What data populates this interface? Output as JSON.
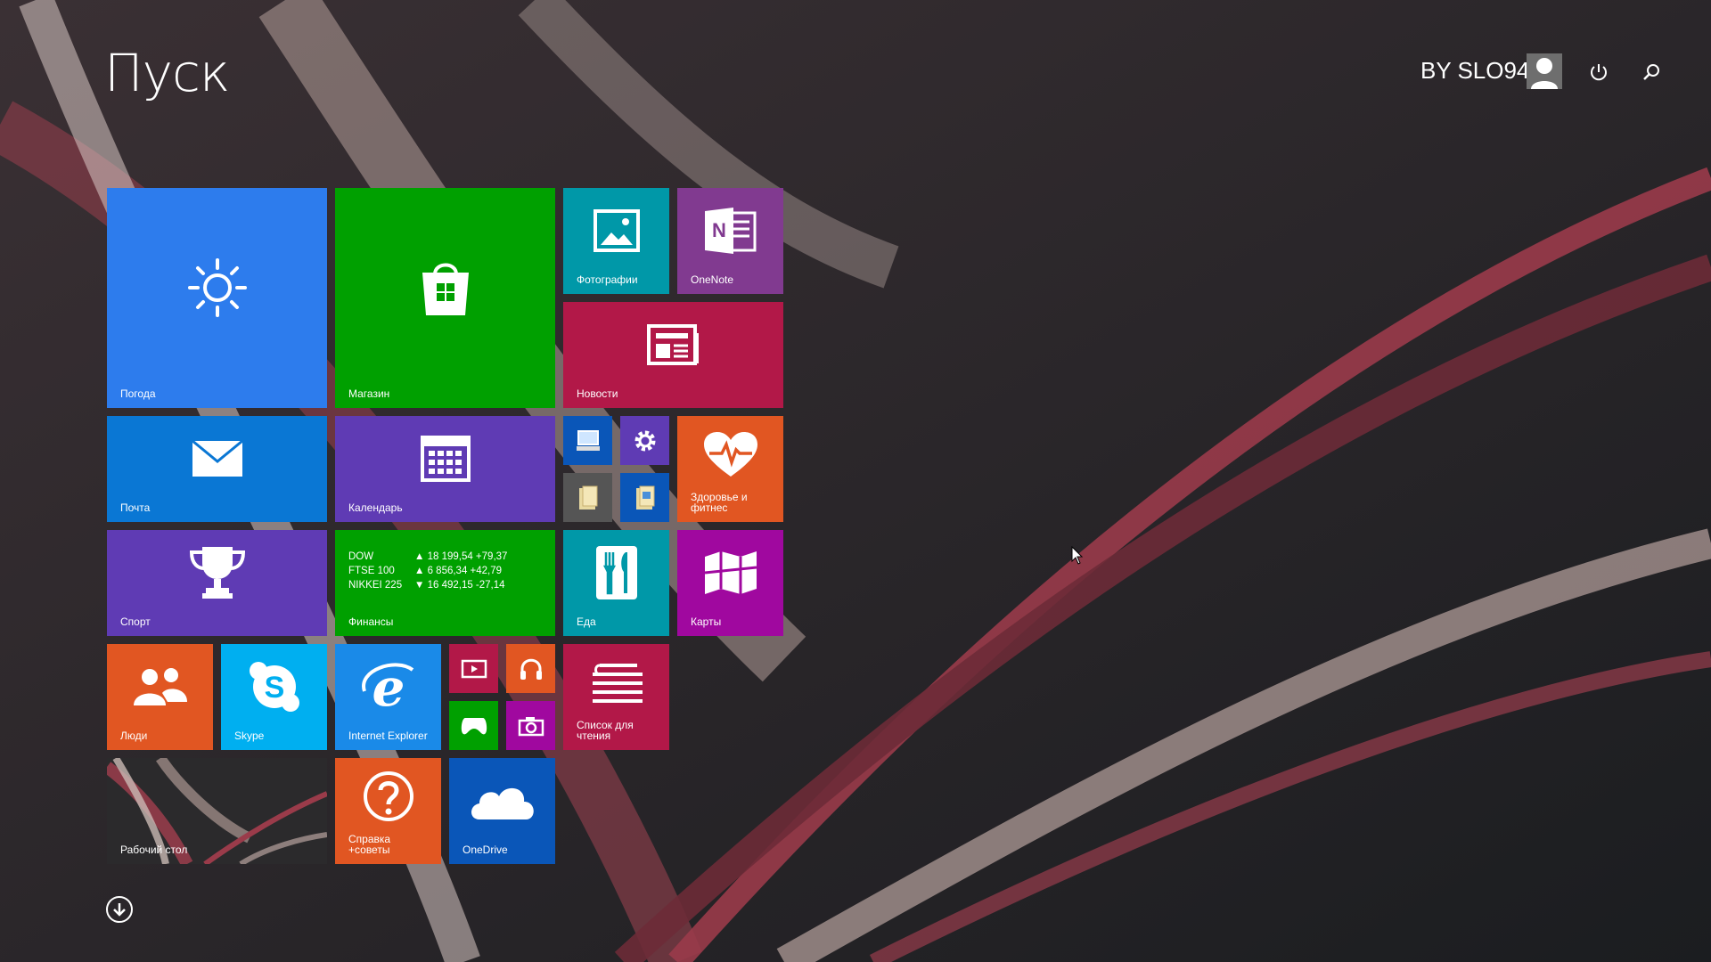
{
  "start": {
    "title": "Пуск"
  },
  "user": {
    "name": "BY SLO94"
  },
  "icons": {
    "power": "power-icon",
    "search": "search-icon",
    "down": "arrow-down-circle-icon"
  },
  "tiles": {
    "weather": {
      "label": "Погода",
      "color": "#2d7ced"
    },
    "store": {
      "label": "Магазин",
      "color": "#00a000"
    },
    "photos": {
      "label": "Фотографии",
      "color": "#0098a8"
    },
    "onenote": {
      "label": "OneNote",
      "color": "#813a90"
    },
    "news": {
      "label": "Новости",
      "color": "#b21848"
    },
    "mail": {
      "label": "Почта",
      "color": "#0a77d4"
    },
    "calendar": {
      "label": "Календарь",
      "color": "#5f3bb4"
    },
    "health": {
      "label": "Здоровье и фитнес",
      "color": "#e15622"
    },
    "sport": {
      "label": "Спорт",
      "color": "#5f3bb4"
    },
    "finance": {
      "label": "Финансы",
      "color": "#00a000",
      "rows": [
        {
          "name": "DOW",
          "value": "▲ 18 199,54 +79,37"
        },
        {
          "name": "FTSE 100",
          "value": "▲ 6 856,34 +42,79"
        },
        {
          "name": "NIKKEI 225",
          "value": "▼ 16 492,15 -27,14"
        }
      ]
    },
    "food": {
      "label": "Еда",
      "color": "#0098a8"
    },
    "maps": {
      "label": "Карты",
      "color": "#a0089f"
    },
    "people": {
      "label": "Люди",
      "color": "#e15622"
    },
    "skype": {
      "label": "Skype",
      "color": "#00aff0"
    },
    "ie": {
      "label": "Internet Explorer",
      "color": "#1a8ae8"
    },
    "reading": {
      "label": "Список для чтения",
      "color": "#b21848"
    },
    "desktop": {
      "label": "Рабочий стол"
    },
    "help": {
      "label": "Справка +советы",
      "color": "#e15622"
    },
    "onedrive": {
      "label": "OneDrive",
      "color": "#0a56b8"
    }
  },
  "small_tiles": {
    "computer": {
      "icon": "computer-icon",
      "color": "#0a56b8"
    },
    "settings": {
      "icon": "gear-icon",
      "color": "#5f3bb4"
    },
    "folder1": {
      "icon": "folder-icon",
      "color": "#555555"
    },
    "folder2": {
      "icon": "folder-icon",
      "color": "#0a56b8"
    },
    "video": {
      "icon": "video-icon",
      "color": "#b21848"
    },
    "music": {
      "icon": "headphones-icon",
      "color": "#e15622"
    },
    "games": {
      "icon": "gamepad-icon",
      "color": "#00a000"
    },
    "camera": {
      "icon": "camera-icon",
      "color": "#a0089f"
    }
  }
}
